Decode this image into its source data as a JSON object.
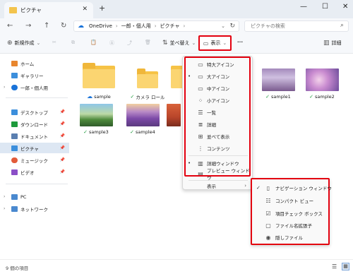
{
  "window": {
    "tab_title": "ピクチャ",
    "new_tab": "+",
    "minimize": "—",
    "maximize": "☐",
    "close": "✕"
  },
  "address": {
    "breadcrumbs": [
      "OneDrive",
      "一郎・個人用",
      "ピクチャ"
    ],
    "search_placeholder": "ピクチャの検索"
  },
  "toolbar": {
    "new_label": "新規作成",
    "sort_label": "並べ替え",
    "view_label": "表示",
    "more_label": "···",
    "details_label": "詳細"
  },
  "sidebar": {
    "items": [
      {
        "label": "ホーム",
        "color": "#e8862e"
      },
      {
        "label": "ギャラリー",
        "color": "#3c8fdc"
      },
      {
        "label": "一郎・個人用",
        "color": "#1a73d9"
      },
      {
        "label": "デスクトップ",
        "color": "#3c8fdc"
      },
      {
        "label": "ダウンロード",
        "color": "#1d9a3c"
      },
      {
        "label": "ドキュメント",
        "color": "#5a7fb0"
      },
      {
        "label": "ピクチャ",
        "color": "#3c8fdc"
      },
      {
        "label": "ミュージック",
        "color": "#e25b3a"
      },
      {
        "label": "ビデオ",
        "color": "#8b4fc7"
      },
      {
        "label": "PC",
        "color": "#4a89cf"
      },
      {
        "label": "ネットワーク",
        "color": "#4a89cf"
      }
    ]
  },
  "files": [
    {
      "name": "sample",
      "kind": "folder",
      "status": "cloud"
    },
    {
      "name": "カメラ ロール",
      "kind": "folder",
      "status": "ok"
    },
    {
      "name": "sample1",
      "kind": "image",
      "status": "ok"
    },
    {
      "name": "sample2",
      "kind": "image",
      "status": "ok"
    },
    {
      "name": "sample3",
      "kind": "image",
      "status": "ok"
    },
    {
      "name": "sample4",
      "kind": "image",
      "status": "ok"
    }
  ],
  "view_menu": {
    "items": [
      {
        "label": "特大アイコン",
        "icon": "monitor-icon",
        "selected": false
      },
      {
        "label": "大アイコン",
        "icon": "monitor-icon",
        "selected": true
      },
      {
        "label": "中アイコン",
        "icon": "monitor-icon",
        "selected": false
      },
      {
        "label": "小アイコン",
        "icon": "grid-icon",
        "selected": false
      },
      {
        "label": "一覧",
        "icon": "list-icon",
        "selected": false
      },
      {
        "label": "詳細",
        "icon": "details-icon",
        "selected": false
      },
      {
        "label": "並べて表示",
        "icon": "tiles-icon",
        "selected": false
      },
      {
        "label": "コンテンツ",
        "icon": "content-icon",
        "selected": false
      },
      {
        "label": "詳細ウィンドウ",
        "icon": "details-pane-icon",
        "selected": true
      },
      {
        "label": "プレビュー ウィンドウ",
        "icon": "preview-pane-icon",
        "selected": false
      },
      {
        "label": "表示",
        "icon": "",
        "selected": false
      }
    ]
  },
  "show_submenu": {
    "items": [
      {
        "label": "ナビゲーション ウィンドウ",
        "checked": true
      },
      {
        "label": "コンパクト ビュー",
        "checked": false
      },
      {
        "label": "項目チェック ボックス",
        "checked": false
      },
      {
        "label": "ファイル名拡張子",
        "checked": false
      },
      {
        "label": "隠しファイル",
        "checked": false
      }
    ]
  },
  "status": {
    "item_count": "9 個の項目"
  }
}
